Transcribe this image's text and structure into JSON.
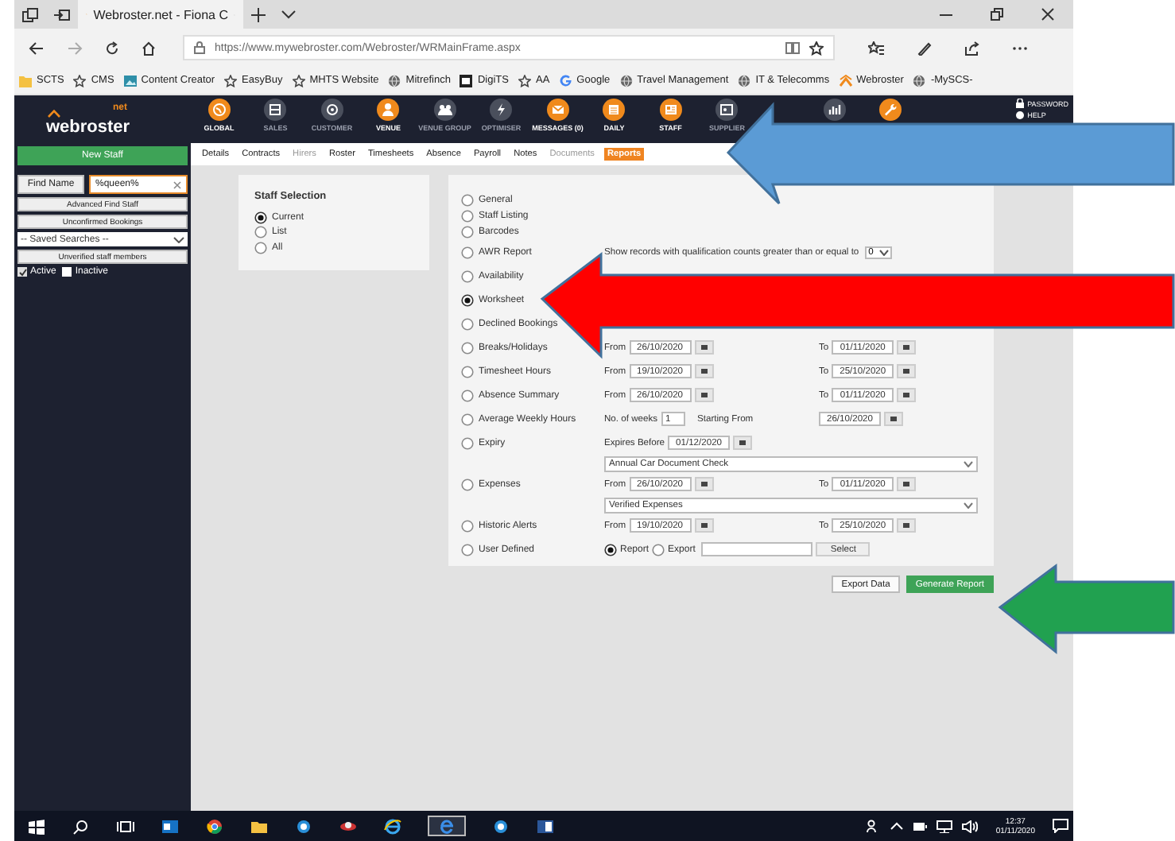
{
  "browser": {
    "tab_title": "Webroster.net - Fiona C",
    "address": "https://www.mywebroster.com/Webroster/WRMainFrame.aspx"
  },
  "favorites": [
    {
      "label": "SCTS",
      "kind": "folder"
    },
    {
      "label": "CMS",
      "kind": "star"
    },
    {
      "label": "Content Creator",
      "kind": "image"
    },
    {
      "label": "EasyBuy",
      "kind": "star"
    },
    {
      "label": "MHTS Website",
      "kind": "star"
    },
    {
      "label": "Mitrefinch",
      "kind": "globe"
    },
    {
      "label": "DigiTS",
      "kind": "badge"
    },
    {
      "label": "AA",
      "kind": "star"
    },
    {
      "label": "Google",
      "kind": "google"
    },
    {
      "label": "Travel Management",
      "kind": "globe"
    },
    {
      "label": "IT & Telecomms",
      "kind": "globe"
    },
    {
      "label": "Webroster",
      "kind": "app"
    },
    {
      "label": "-MySCS-",
      "kind": "globe"
    }
  ],
  "app_header": {
    "logo": "webroster",
    "logo_suffix": "net",
    "nav": [
      {
        "label": "GLOBAL",
        "disabled": false
      },
      {
        "label": "SALES",
        "disabled": true
      },
      {
        "label": "CUSTOMER",
        "disabled": true
      },
      {
        "label": "VENUE",
        "disabled": false
      },
      {
        "label": "VENUE GROUP",
        "disabled": true
      },
      {
        "label": "OPTIMISER",
        "disabled": true
      },
      {
        "label": "MESSAGES (0)",
        "disabled": false
      },
      {
        "label": "DAILY",
        "disabled": false
      },
      {
        "label": "STAFF",
        "disabled": false
      },
      {
        "label": "SUPPLIER",
        "disabled": true
      },
      {
        "disabled": true
      },
      {
        "disabled": false
      }
    ],
    "links": [
      "PASSWORD",
      "HELP"
    ]
  },
  "sidebar": {
    "new_button": "New Staff",
    "find_button": "Find Name",
    "find_value": "%queen%",
    "buttons": [
      "Advanced Find Staff",
      "Unconfirmed Bookings"
    ],
    "saved_searches": "-- Saved Searches --",
    "unverified_button": "Unverified staff members",
    "filters": [
      {
        "label": "Active",
        "checked": true
      },
      {
        "label": "Inactive",
        "checked": false
      }
    ]
  },
  "subtabs": [
    {
      "label": "Details",
      "selected": false,
      "disabled": false
    },
    {
      "label": "Contracts",
      "selected": false,
      "disabled": false
    },
    {
      "label": "Hirers",
      "selected": false,
      "disabled": true
    },
    {
      "label": "Roster",
      "selected": false,
      "disabled": false
    },
    {
      "label": "Timesheets",
      "selected": false,
      "disabled": false
    },
    {
      "label": "Absence",
      "selected": false,
      "disabled": false
    },
    {
      "label": "Payroll",
      "selected": false,
      "disabled": false
    },
    {
      "label": "Notes",
      "selected": false,
      "disabled": false
    },
    {
      "label": "Documents",
      "selected": false,
      "disabled": true
    },
    {
      "label": "Reports",
      "selected": true,
      "disabled": false
    }
  ],
  "staff_selection": {
    "title": "Staff Selection",
    "options": [
      {
        "label": "Current",
        "selected": true
      },
      {
        "label": "List",
        "selected": false
      },
      {
        "label": "All",
        "selected": false
      }
    ]
  },
  "reports": [
    {
      "label": "General",
      "selected": false,
      "kind": "plain"
    },
    {
      "label": "Staff Listing",
      "selected": false,
      "kind": "plain"
    },
    {
      "label": "Barcodes",
      "selected": false,
      "kind": "plain"
    },
    {
      "label": "AWR Report",
      "selected": false,
      "kind": "qualification",
      "text": "Show records with qualification counts greater than or equal to",
      "value": "0"
    },
    {
      "label": "Availability",
      "selected": false,
      "kind": "plain"
    },
    {
      "label": "Worksheet",
      "selected": true,
      "kind": "plain"
    },
    {
      "label": "Declined Bookings",
      "selected": false,
      "kind": "plain"
    },
    {
      "label": "Breaks/Holidays",
      "selected": false,
      "kind": "range",
      "from_label": "From",
      "from": "26/10/2020",
      "to_label": "To",
      "to": "01/11/2020"
    },
    {
      "label": "Timesheet Hours",
      "selected": false,
      "kind": "range",
      "from_label": "From",
      "from": "19/10/2020",
      "to_label": "To",
      "to": "25/10/2020"
    },
    {
      "label": "Absence Summary",
      "selected": false,
      "kind": "range",
      "from_label": "From",
      "from": "26/10/2020",
      "to_label": "To",
      "to": "01/11/2020"
    },
    {
      "label": "Average Weekly Hours",
      "selected": false,
      "kind": "weeks",
      "weeks_label": "No. of weeks",
      "weeks": "1",
      "start_label": "Starting From",
      "start": "26/10/2020"
    },
    {
      "label": "Expiry",
      "selected": false,
      "kind": "expiry",
      "before_label": "Expires Before",
      "before": "01/12/2020",
      "dropdown": "Annual Car Document Check"
    },
    {
      "label": "Expenses",
      "selected": false,
      "kind": "range",
      "from_label": "From",
      "from": "26/10/2020",
      "to_label": "To",
      "to": "01/11/2020",
      "dropdown": "Verified Expenses"
    },
    {
      "label": "Historic Alerts",
      "selected": false,
      "kind": "range",
      "from_label": "From",
      "from": "19/10/2020",
      "to_label": "To",
      "to": "25/10/2020"
    },
    {
      "label": "User Defined",
      "selected": false,
      "kind": "user_defined",
      "options": [
        {
          "label": "Report",
          "selected": true
        },
        {
          "label": "Export",
          "selected": false
        }
      ],
      "button": "Select"
    }
  ],
  "actions": [
    {
      "label": "Export Data",
      "kind": "secondary"
    },
    {
      "label": "Generate Report",
      "kind": "primary"
    }
  ],
  "taskbar": {
    "time": "12:37",
    "date": "01/11/2020"
  }
}
